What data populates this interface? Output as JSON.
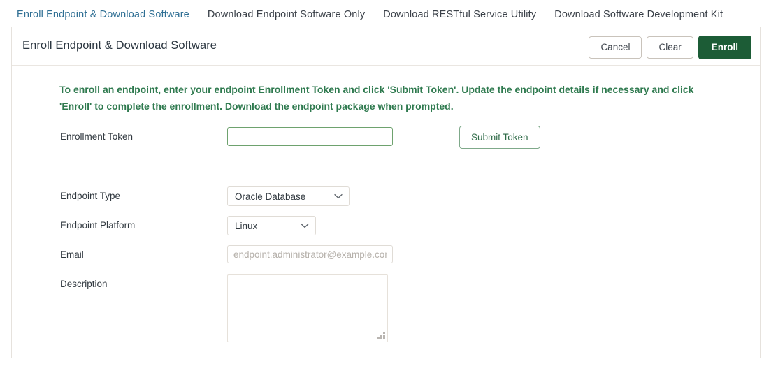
{
  "tabs": [
    {
      "label": "Enroll Endpoint & Download Software",
      "active": true
    },
    {
      "label": "Download Endpoint Software Only",
      "active": false
    },
    {
      "label": "Download RESTful Service Utility",
      "active": false
    },
    {
      "label": "Download Software Development Kit",
      "active": false
    }
  ],
  "panel": {
    "title": "Enroll Endpoint & Download Software",
    "actions": {
      "cancel_label": "Cancel",
      "clear_label": "Clear",
      "enroll_label": "Enroll"
    }
  },
  "notice": {
    "text": "To enroll an endpoint, enter your endpoint Enrollment Token and click 'Submit Token'. Update the endpoint details if necessary and click 'Enroll' to complete the enrollment. Download the endpoint package when prompted."
  },
  "form": {
    "enrollment_token": {
      "label": "Enrollment Token",
      "value": "",
      "placeholder": "",
      "submit_label": "Submit Token"
    },
    "endpoint_type": {
      "label": "Endpoint Type",
      "value": "Oracle Database",
      "options": [
        "Oracle Database"
      ]
    },
    "endpoint_platform": {
      "label": "Endpoint Platform",
      "value": "Linux",
      "options": [
        "Linux"
      ]
    },
    "email": {
      "label": "Email",
      "value": "",
      "placeholder": "endpoint.administrator@example.com"
    },
    "description": {
      "label": "Description",
      "value": "",
      "placeholder": ""
    }
  },
  "colors": {
    "accent_green": "#1c5c36",
    "notice_green": "#2f7a4f",
    "tab_active_text": "#2f6f94",
    "tab_underline": "#5c8c5c",
    "focus_border": "#6ea26e",
    "border": "#e6e2dd"
  }
}
